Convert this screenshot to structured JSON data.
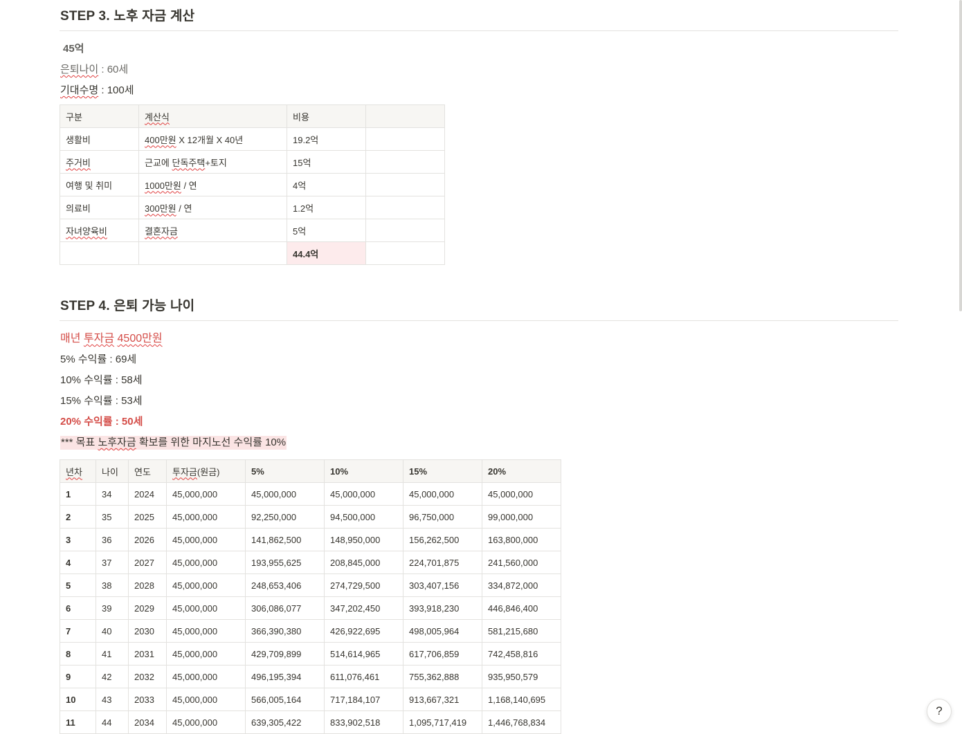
{
  "step3": {
    "title": "STEP 3. 노후 자금 계산",
    "total_label": "45억",
    "retire_age_key": "은퇴나이",
    "retire_age_value": " : 60세",
    "life_key": "기대수명",
    "life_value": " : 100세",
    "table": {
      "headers": [
        "구분",
        "계산식",
        "비용",
        ""
      ],
      "rows": [
        [
          "생활비",
          "400만원 X 12개월 X 40년",
          "19.2억",
          ""
        ],
        [
          "주거비",
          "근교에 단독주택+토지",
          "15억",
          ""
        ],
        [
          "여행 및 취미",
          "1000만원 / 연",
          "4억",
          ""
        ],
        [
          "의료비",
          "300만원 / 연",
          "1.2억",
          ""
        ],
        [
          "자녀양육비",
          "결혼자금",
          "5억",
          ""
        ],
        [
          "",
          "",
          "44.4억",
          ""
        ]
      ]
    }
  },
  "step4": {
    "title": "STEP 4. 은퇴 가능 나이",
    "invest_line": "매년 투자금 4500만원",
    "rates": [
      "5% 수익률 : 69세",
      "10% 수익률 : 58세",
      "15% 수익률 : 53세",
      "20% 수익률 : 50세"
    ],
    "note": "*** 목표 노후자금 확보를 위한 마지노선 수익률 10%",
    "table": {
      "headers": [
        "년차",
        "나이",
        "연도",
        "투자금(원금)",
        "5%",
        "10%",
        "15%",
        "20%"
      ],
      "rows": [
        [
          "1",
          "34",
          "2024",
          "45,000,000",
          "45,000,000",
          "45,000,000",
          "45,000,000",
          "45,000,000"
        ],
        [
          "2",
          "35",
          "2025",
          "45,000,000",
          "92,250,000",
          "94,500,000",
          "96,750,000",
          "99,000,000"
        ],
        [
          "3",
          "36",
          "2026",
          "45,000,000",
          "141,862,500",
          "148,950,000",
          "156,262,500",
          "163,800,000"
        ],
        [
          "4",
          "37",
          "2027",
          "45,000,000",
          "193,955,625",
          "208,845,000",
          "224,701,875",
          "241,560,000"
        ],
        [
          "5",
          "38",
          "2028",
          "45,000,000",
          "248,653,406",
          "274,729,500",
          "303,407,156",
          "334,872,000"
        ],
        [
          "6",
          "39",
          "2029",
          "45,000,000",
          "306,086,077",
          "347,202,450",
          "393,918,230",
          "446,846,400"
        ],
        [
          "7",
          "40",
          "2030",
          "45,000,000",
          "366,390,380",
          "426,922,695",
          "498,005,964",
          "581,215,680"
        ],
        [
          "8",
          "41",
          "2031",
          "45,000,000",
          "429,709,899",
          "514,614,965",
          "617,706,859",
          "742,458,816"
        ],
        [
          "9",
          "42",
          "2032",
          "45,000,000",
          "496,195,394",
          "611,076,461",
          "755,362,888",
          "935,950,579"
        ],
        [
          "10",
          "43",
          "2033",
          "45,000,000",
          "566,005,164",
          "717,184,107",
          "913,667,321",
          "1,168,140,695"
        ],
        [
          "11",
          "44",
          "2034",
          "45,000,000",
          "639,305,422",
          "833,902,518",
          "1,095,717,419",
          "1,446,768,834"
        ]
      ]
    }
  },
  "help_button_label": "?"
}
